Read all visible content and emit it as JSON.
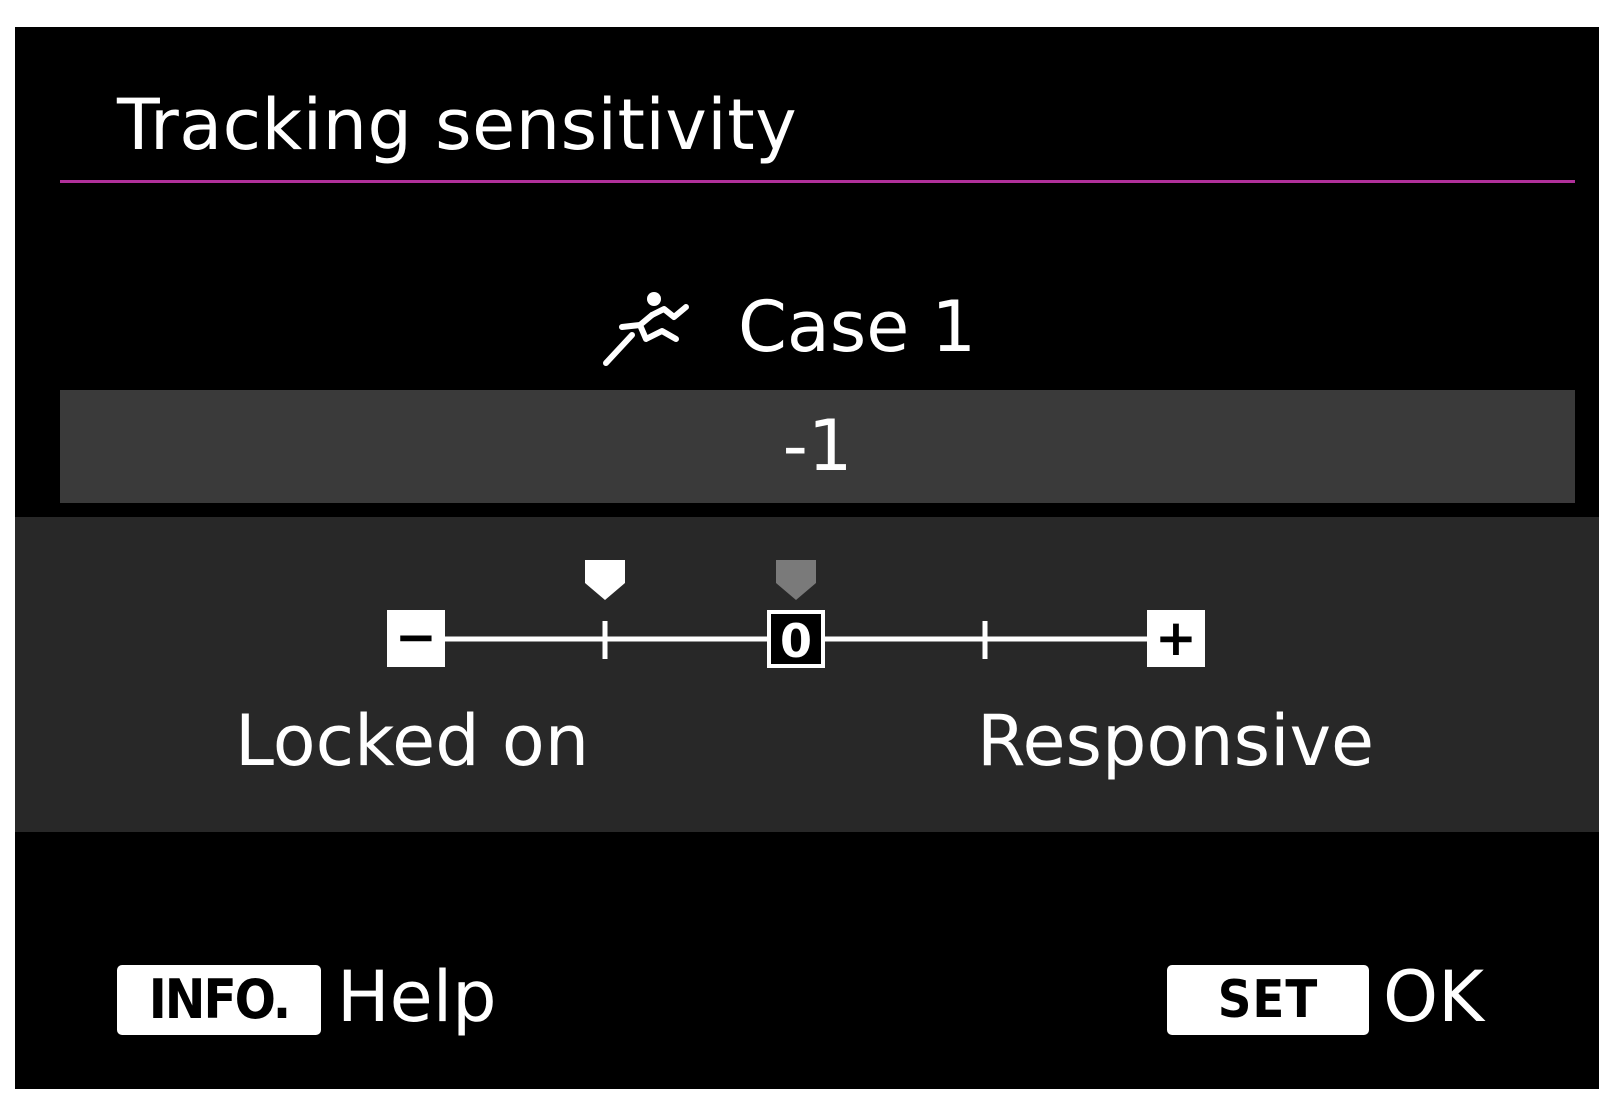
{
  "screen": {
    "title": "Tracking sensitivity",
    "accent_color": "#b0309a"
  },
  "case": {
    "icon": "sports-runner-icon",
    "label": "Case 1"
  },
  "setting": {
    "value": "-1"
  },
  "scale": {
    "min_label": "−",
    "center_label": "0",
    "max_label": "+",
    "left_text": "Locked on",
    "right_text": "Responsive",
    "range": [
      -2,
      2
    ],
    "ticks": [
      -2,
      -1,
      0,
      1,
      2
    ],
    "current": -1,
    "default": 0,
    "current_marker_color": "#ffffff",
    "default_marker_color": "#7a7a7a"
  },
  "footer": {
    "info_key": "INFO.",
    "info_action": "Help",
    "set_key": "SET",
    "set_action": "OK"
  }
}
